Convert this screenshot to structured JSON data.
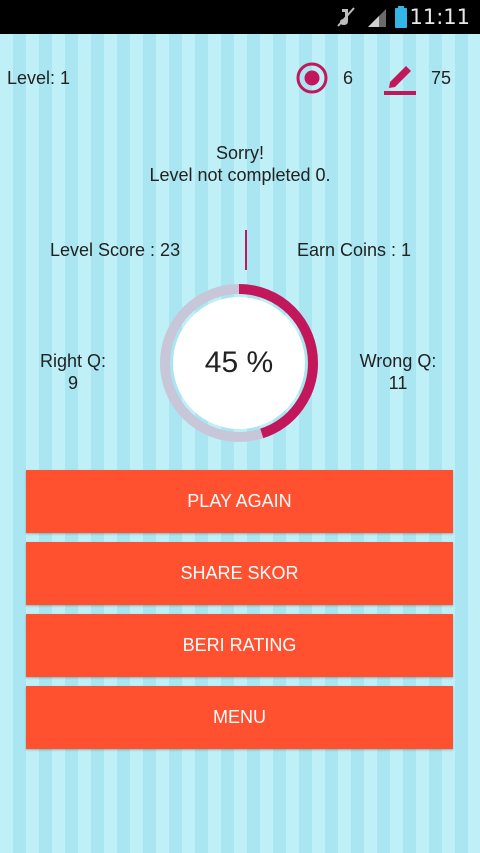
{
  "status_bar": {
    "time": "11:11",
    "icons": [
      "mute-icon",
      "signal-icon",
      "battery-icon"
    ]
  },
  "header": {
    "level_label": "Level: 1",
    "target_count": "6",
    "pencil_count": "75",
    "icons": [
      "target-icon",
      "pencil-icon"
    ],
    "accent_color": "#c2185b"
  },
  "message": {
    "line1": "Sorry!",
    "line2": "Level not completed 0."
  },
  "scores": {
    "level_score": "Level Score : 23",
    "earn_coins": "Earn Coins :  1"
  },
  "stats": {
    "right_label": "Right Q:",
    "right_value": "9",
    "wrong_label": "Wrong Q:",
    "wrong_value": "11"
  },
  "progress": {
    "percent_text": "45 %",
    "fraction": 0.45,
    "fill_color": "#c2185b",
    "track_color": "#c7c7d9"
  },
  "buttons": {
    "play_again": "PLAY AGAIN",
    "share_score": "SHARE SKOR",
    "rate": "BERI RATING",
    "menu": "MENU",
    "color": "#ff5030"
  }
}
